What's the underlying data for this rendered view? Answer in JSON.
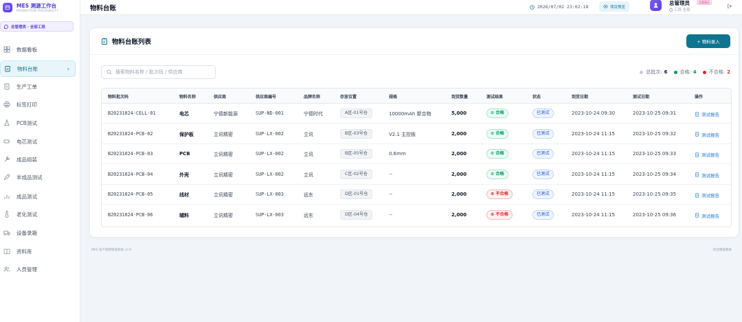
{
  "brand": {
    "title": "MES 溯源工作台",
    "subtitle": "PRODUCTION TRACEABILITY"
  },
  "role_badge": "总管理员 · 全部工段",
  "sidebar": {
    "items": [
      {
        "label": "数据看板",
        "icon": "dashboard-icon",
        "active": false
      },
      {
        "label": "物料台账",
        "icon": "clipboard-icon",
        "active": true
      },
      {
        "label": "生产工单",
        "icon": "document-icon",
        "active": false
      },
      {
        "label": "标签打印",
        "icon": "printer-icon",
        "active": false
      },
      {
        "label": "PCB测试",
        "icon": "flask-icon",
        "active": false
      },
      {
        "label": "电芯测试",
        "icon": "battery-icon",
        "active": false
      },
      {
        "label": "成品组装",
        "icon": "wrench-icon",
        "active": false
      },
      {
        "label": "半成品测试",
        "icon": "pen-icon",
        "active": false
      },
      {
        "label": "成品测试",
        "icon": "bar-chart-icon",
        "active": false
      },
      {
        "label": "老化测试",
        "icon": "thermometer-icon",
        "active": false
      },
      {
        "label": "设备录箱",
        "icon": "truck-icon",
        "active": false
      },
      {
        "label": "资料库",
        "icon": "book-icon",
        "active": false
      },
      {
        "label": "人员管理",
        "icon": "users-icon",
        "active": false
      }
    ]
  },
  "header": {
    "title": "物料台账",
    "clock": "2026/07/02 23:02:18",
    "preview_label": "项目预览",
    "user_name": "总管理员",
    "user_role": "总管理员",
    "user_station": "工段 全部"
  },
  "card": {
    "title": "物料台账列表",
    "add_button": "+ 物料录入",
    "search_placeholder": "搜索物料名称 / 批次码 / 供应商",
    "stats": {
      "total_label": "总批次:",
      "total_value": "6",
      "pass_label": "合格:",
      "pass_value": "4",
      "fail_label": "不合格:",
      "fail_value": "2"
    }
  },
  "table": {
    "headers": [
      "物料批次码",
      "物料名称",
      "供应商",
      "供应商编号",
      "品牌名称",
      "存放位置",
      "规格",
      "到货数量",
      "测试结果",
      "状态",
      "到货日期",
      "测试日期",
      "操作"
    ],
    "rows": [
      {
        "batch": "B20231024-CELL-01",
        "name": "电芯",
        "supplier": "宁德新能源",
        "supplier_no": "SUP-ND-001",
        "brand": "宁德时代",
        "location": "A区-01号仓",
        "spec": "10000mAh 聚合物",
        "qty": "5,000",
        "result": "⊙ 合格",
        "result_type": "ok",
        "status": "已测试",
        "arrival": "2023-10-24 09:30",
        "test_date": "2023-10-25 09:31",
        "action": "测试报告"
      },
      {
        "batch": "B20231024-PCB-02",
        "name": "保护板",
        "supplier": "立讯精密",
        "supplier_no": "SUP-LX-002",
        "brand": "立讯",
        "location": "B区-03号仓",
        "spec": "V2.1 主控板",
        "qty": "2,000",
        "result": "⊙ 合格",
        "result_type": "ok",
        "status": "已测试",
        "arrival": "2023-10-24 11:15",
        "test_date": "2023-10-25 09:32",
        "action": "测试报告"
      },
      {
        "batch": "B20231024-PCB-03",
        "name": "PCB",
        "supplier": "立讯精密",
        "supplier_no": "SUP-LX-002",
        "brand": "立讯",
        "location": "B区-05号仓",
        "spec": "0.6mm",
        "qty": "2,000",
        "result": "⊙ 合格",
        "result_type": "ok",
        "status": "已测试",
        "arrival": "2023-10-24 11:15",
        "test_date": "2023-10-25 09:33",
        "action": "测试报告"
      },
      {
        "batch": "B20231024-PCB-04",
        "name": "外壳",
        "supplier": "立讯精密",
        "supplier_no": "SUP-LX-002",
        "brand": "立讯",
        "location": "C区-02号仓",
        "spec": "--",
        "qty": "2,000",
        "result": "⊙ 合格",
        "result_type": "ok",
        "status": "已测试",
        "arrival": "2023-10-24 11:15",
        "test_date": "2023-10-25 09:34",
        "action": "测试报告"
      },
      {
        "batch": "B20231024-PCB-05",
        "name": "线材",
        "supplier": "立讯精密",
        "supplier_no": "SUP-LX-003",
        "brand": "远东",
        "location": "D区-01号仓",
        "spec": "--",
        "qty": "2,000",
        "result": "⊗ 不合格",
        "result_type": "ng",
        "status": "已测试",
        "arrival": "2023-10-24 11:15",
        "test_date": "2023-10-25 09:35",
        "action": "测试报告"
      },
      {
        "batch": "B20231024-PCB-06",
        "name": "辅料",
        "supplier": "立讯精密",
        "supplier_no": "SUP-LX-003",
        "brand": "远东",
        "location": "D区-04号仓",
        "spec": "--",
        "qty": "2,000",
        "result": "⊗ 不合格",
        "result_type": "ng",
        "status": "已测试",
        "arrival": "2023-10-24 11:15",
        "test_date": "2023-10-25 09:36",
        "action": "测试报告"
      }
    ]
  },
  "footer": {
    "left": "MES 生产溯源管理系统 v2.0",
    "right": "综合数据看板"
  },
  "colors": {
    "accent": "#0e7490",
    "brand": "#5b3fe0",
    "pass": "#059669",
    "fail": "#dc2626",
    "status": "#1d4ed8"
  }
}
